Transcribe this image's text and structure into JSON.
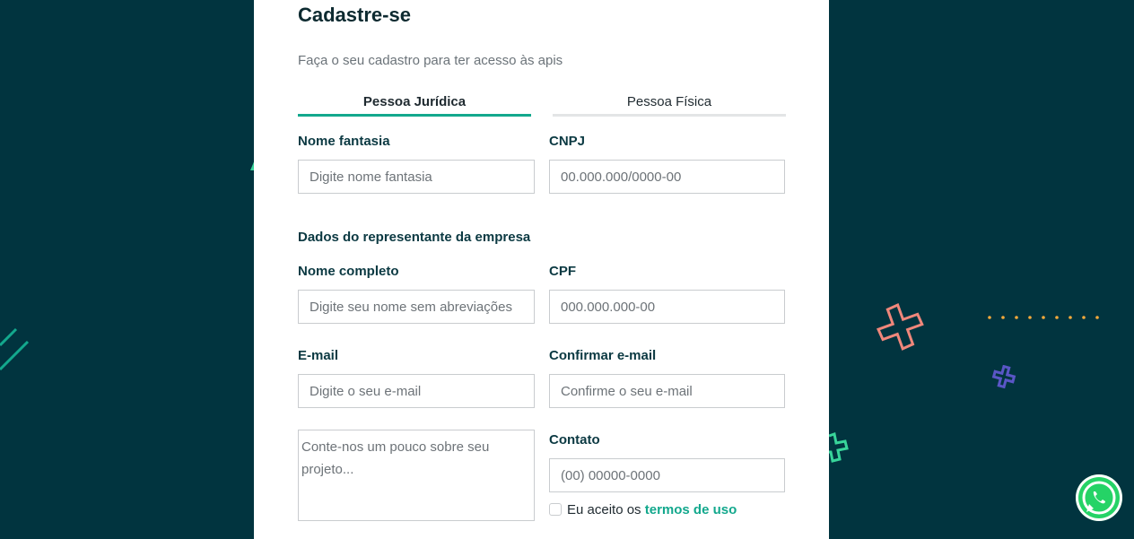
{
  "colors": {
    "background": "#01343f",
    "accent": "#13a88d",
    "label": "#0b3942",
    "whatsapp": "#25d366"
  },
  "form": {
    "title": "Cadastre-se",
    "subtitle": "Faça o seu cadastro para ter acesso às apis",
    "tabs": [
      {
        "label": "Pessoa Jurídica",
        "active": true
      },
      {
        "label": "Pessoa Física",
        "active": false
      }
    ],
    "fields": {
      "nome_fantasia": {
        "label": "Nome fantasia",
        "placeholder": "Digite nome fantasia"
      },
      "cnpj": {
        "label": "CNPJ",
        "placeholder": "00.000.000/0000-00"
      },
      "section_title": "Dados do representante da empresa",
      "nome_completo": {
        "label": "Nome completo",
        "placeholder": "Digite seu nome sem abreviações"
      },
      "cpf": {
        "label": "CPF",
        "placeholder": "000.000.000-00"
      },
      "email": {
        "label": "E-mail",
        "placeholder": "Digite o seu e-mail"
      },
      "confirm_email": {
        "label": "Confirmar e-mail",
        "placeholder": "Confirme o seu e-mail"
      },
      "projeto": {
        "placeholder": "Conte-nos um pouco sobre seu projeto..."
      },
      "contato": {
        "label": "Contato",
        "placeholder": "(00) 00000-0000"
      }
    },
    "terms": {
      "prefix": "Eu aceito os",
      "link": "termos de uso",
      "checked": false
    }
  },
  "icons": {
    "whatsapp": "whatsapp-icon"
  }
}
